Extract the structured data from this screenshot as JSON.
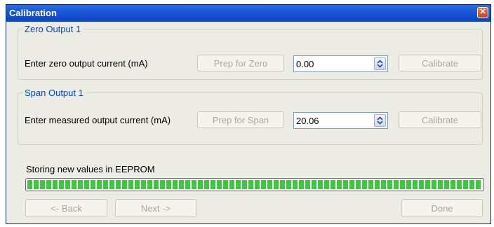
{
  "window": {
    "title": "Calibration"
  },
  "zero_group": {
    "legend": "Zero Output 1",
    "prompt": "Enter zero output current (mA)",
    "prep_label": "Prep for Zero",
    "value": "0.00",
    "calibrate_label": "Calibrate"
  },
  "span_group": {
    "legend": "Span Output 1",
    "prompt": "Enter measured output current (mA)",
    "prep_label": "Prep for Span",
    "value": "20.06",
    "calibrate_label": "Calibrate"
  },
  "status": {
    "text": "Storing new values in EEPROM",
    "progress": 1.0
  },
  "nav": {
    "back_label": "<- Back",
    "next_label": "Next ->",
    "done_label": "Done"
  },
  "colors": {
    "title_bar": "#1955d4",
    "group_legend": "#0046d5",
    "progress_fill": "#3ec83e",
    "disabled_text": "#a9a89d"
  }
}
